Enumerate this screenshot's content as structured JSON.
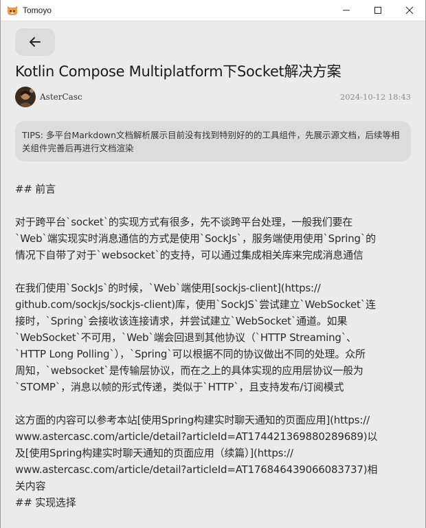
{
  "window": {
    "title": "Tomoyo"
  },
  "article": {
    "title": "Kotlin Compose Multiplatform下Socket解决方案",
    "author": "AsterCasc",
    "date": "2024-10-12 18:43",
    "tips": "TIPS: 多平台Markdown文档解析展示目前没有找到特别好的的工具组件，先展示源文档，后续等相关组件完善后再进行文档渲染",
    "body_lines": [
      "## 前言",
      "",
      "对于跨平台`socket`的实现方式有很多，先不谈跨平台处理，一般我们要在",
      "`Web`端实现实时消息通信的方式是使用`SockJs`，服务端使用使用`Spring`的",
      "情况下自带了对于`websocket`的支持，可以通过集成相关库来完成消息通信",
      "",
      "在我们使用`SockJs`的时候，`Web`端使用[sockjs-client](https://",
      "github.com/sockjs/sockjs-client)库，使用`SockJS`尝试建立`WebSocket`连",
      "接时，`Spring`会接收该连接请求，并尝试建立`WebSocket`通道。如果",
      "`WebSocket`不可用，`Web`端会回退到其他协议（`HTTP Streaming`、",
      "`HTTP Long Polling`），`Spring`可以根据不同的协议做出不同的处理。众所",
      "周知，`websocket`是传输层协议，而在之上的具体实现的应用层协议一般为",
      "`STOMP`，消息以帧的形式传递，类似于`HTTP`，且支持发布/订阅模式",
      "",
      "这方面的内容可以参考本站[使用Spring构建实时聊天通知的页面应用](https://",
      "www.astercasc.com/article/detail?articleId=AT174421369880289689)以",
      "及[使用Spring构建实时聊天通知的页面应用（续篇）](https://",
      "www.astercasc.com/article/detail?articleId=AT176846439066083737)相",
      "关内容",
      "## 实现选择"
    ]
  }
}
